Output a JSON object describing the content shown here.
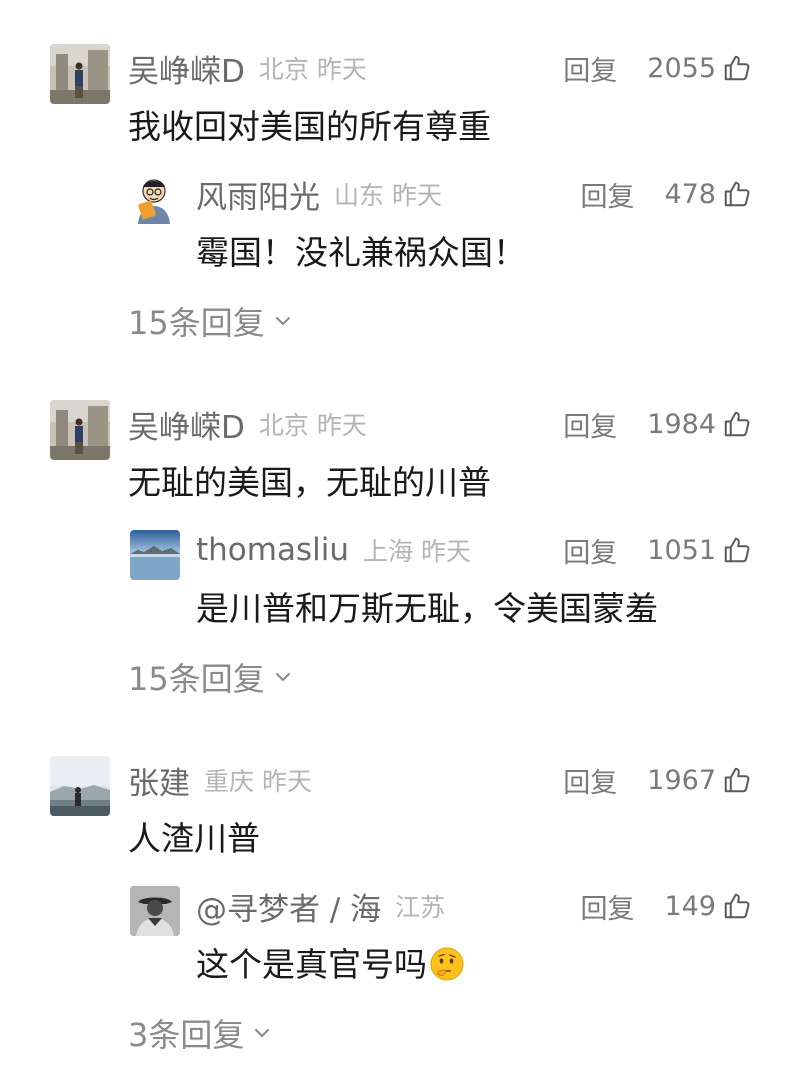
{
  "threads": [
    {
      "comment": {
        "user": "吴峥嵘D",
        "location": "北京",
        "time": "昨天",
        "reply_label": "回复",
        "likes": "2055",
        "text": "我收回对美国的所有尊重"
      },
      "top_reply": {
        "user": "风雨阳光",
        "location": "山东",
        "time": "昨天",
        "reply_label": "回复",
        "likes": "478",
        "text": "霉国！没礼兼祸众国！"
      },
      "more_replies": "15条回复"
    },
    {
      "comment": {
        "user": "吴峥嵘D",
        "location": "北京",
        "time": "昨天",
        "reply_label": "回复",
        "likes": "1984",
        "text": "无耻的美国，无耻的川普"
      },
      "top_reply": {
        "user": "thomasliu",
        "location": "上海",
        "time": "昨天",
        "reply_label": "回复",
        "likes": "1051",
        "text": "是川普和万斯无耻，令美国蒙羞"
      },
      "more_replies": "15条回复"
    },
    {
      "comment": {
        "user": "张建",
        "location": "重庆",
        "time": "昨天",
        "reply_label": "回复",
        "likes": "1967",
        "text": "人渣川普"
      },
      "top_reply": {
        "user": "@寻梦者 / 海",
        "location": "江苏",
        "time": "",
        "reply_label": "回复",
        "likes": "149",
        "text": "这个是真官号吗",
        "emoji": "thinking-face-icon"
      },
      "more_replies": "3条回复"
    }
  ],
  "icons": {
    "like": "thumbs-up-icon",
    "expand": "chevron-down-icon"
  },
  "colors": {
    "name": "#6b6b6b",
    "meta": "#b4b4b4",
    "text": "#1a1a1a",
    "action": "#7a7a7a"
  }
}
